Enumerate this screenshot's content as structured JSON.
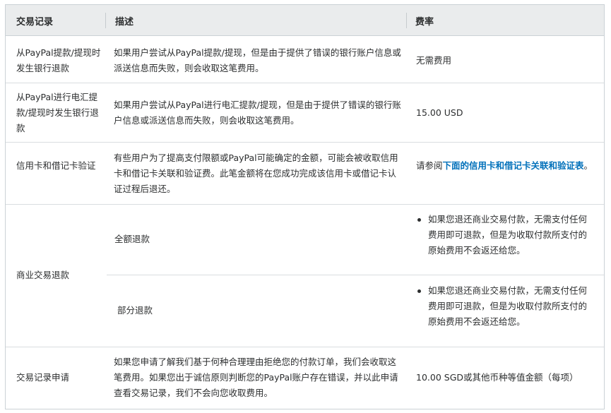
{
  "table": {
    "headers": {
      "record": "交易记录",
      "description": "描述",
      "fee": "费率"
    },
    "rows": [
      {
        "record": "从PayPal提款/提现时发生银行退款",
        "description": "如果用户尝试从PayPal提款/提现，但是由于提供了错误的银行账户信息或派送信息而失败，则会收取这笔费用。",
        "fee": "无需费用"
      },
      {
        "record": "从PayPal进行电汇提款/提现时发生银行退款",
        "description": "如果用户尝试从PayPal进行电汇提款/提现，但是由于提供了错误的银行账户信息或派送信息而失败，则会收取这笔费用。",
        "fee": "15.00 USD"
      },
      {
        "record": "信用卡和借记卡验证",
        "description": "有些用户为了提高支付限额或PayPal可能确定的金额，可能会被收取信用卡和借记卡关联和验证费。此笔金额将在您成功完成该信用卡或借记卡认证过程后退还。",
        "fee_prefix": "请参阅",
        "fee_link": "下面的信用卡和借记卡关联和验证表",
        "fee_suffix": "。"
      },
      {
        "record": "商业交易退款",
        "sub": [
          {
            "description": "全额退款",
            "fee": "如果您退还商业交易付款，无需支付任何费用即可退款，但是为收取付款所支付的原始费用不会返还给您。"
          },
          {
            "description": "部分退款",
            "fee": "如果您退还商业交易付款，无需支付任何费用即可退款，但是为收取付款所支付的原始费用不会返还给您。"
          }
        ]
      },
      {
        "record": "交易记录申请",
        "description": "如果您申请了解我们基于何种合理理由拒绝您的付款订单，我们会收取这笔费用。如果您出于诚信原则判断您的PayPal账户存在错误，并以此申请查看交易记录，我们不会向您收取费用。",
        "fee": "10.00 SGD或其他币种等值金额（每项）"
      }
    ]
  }
}
